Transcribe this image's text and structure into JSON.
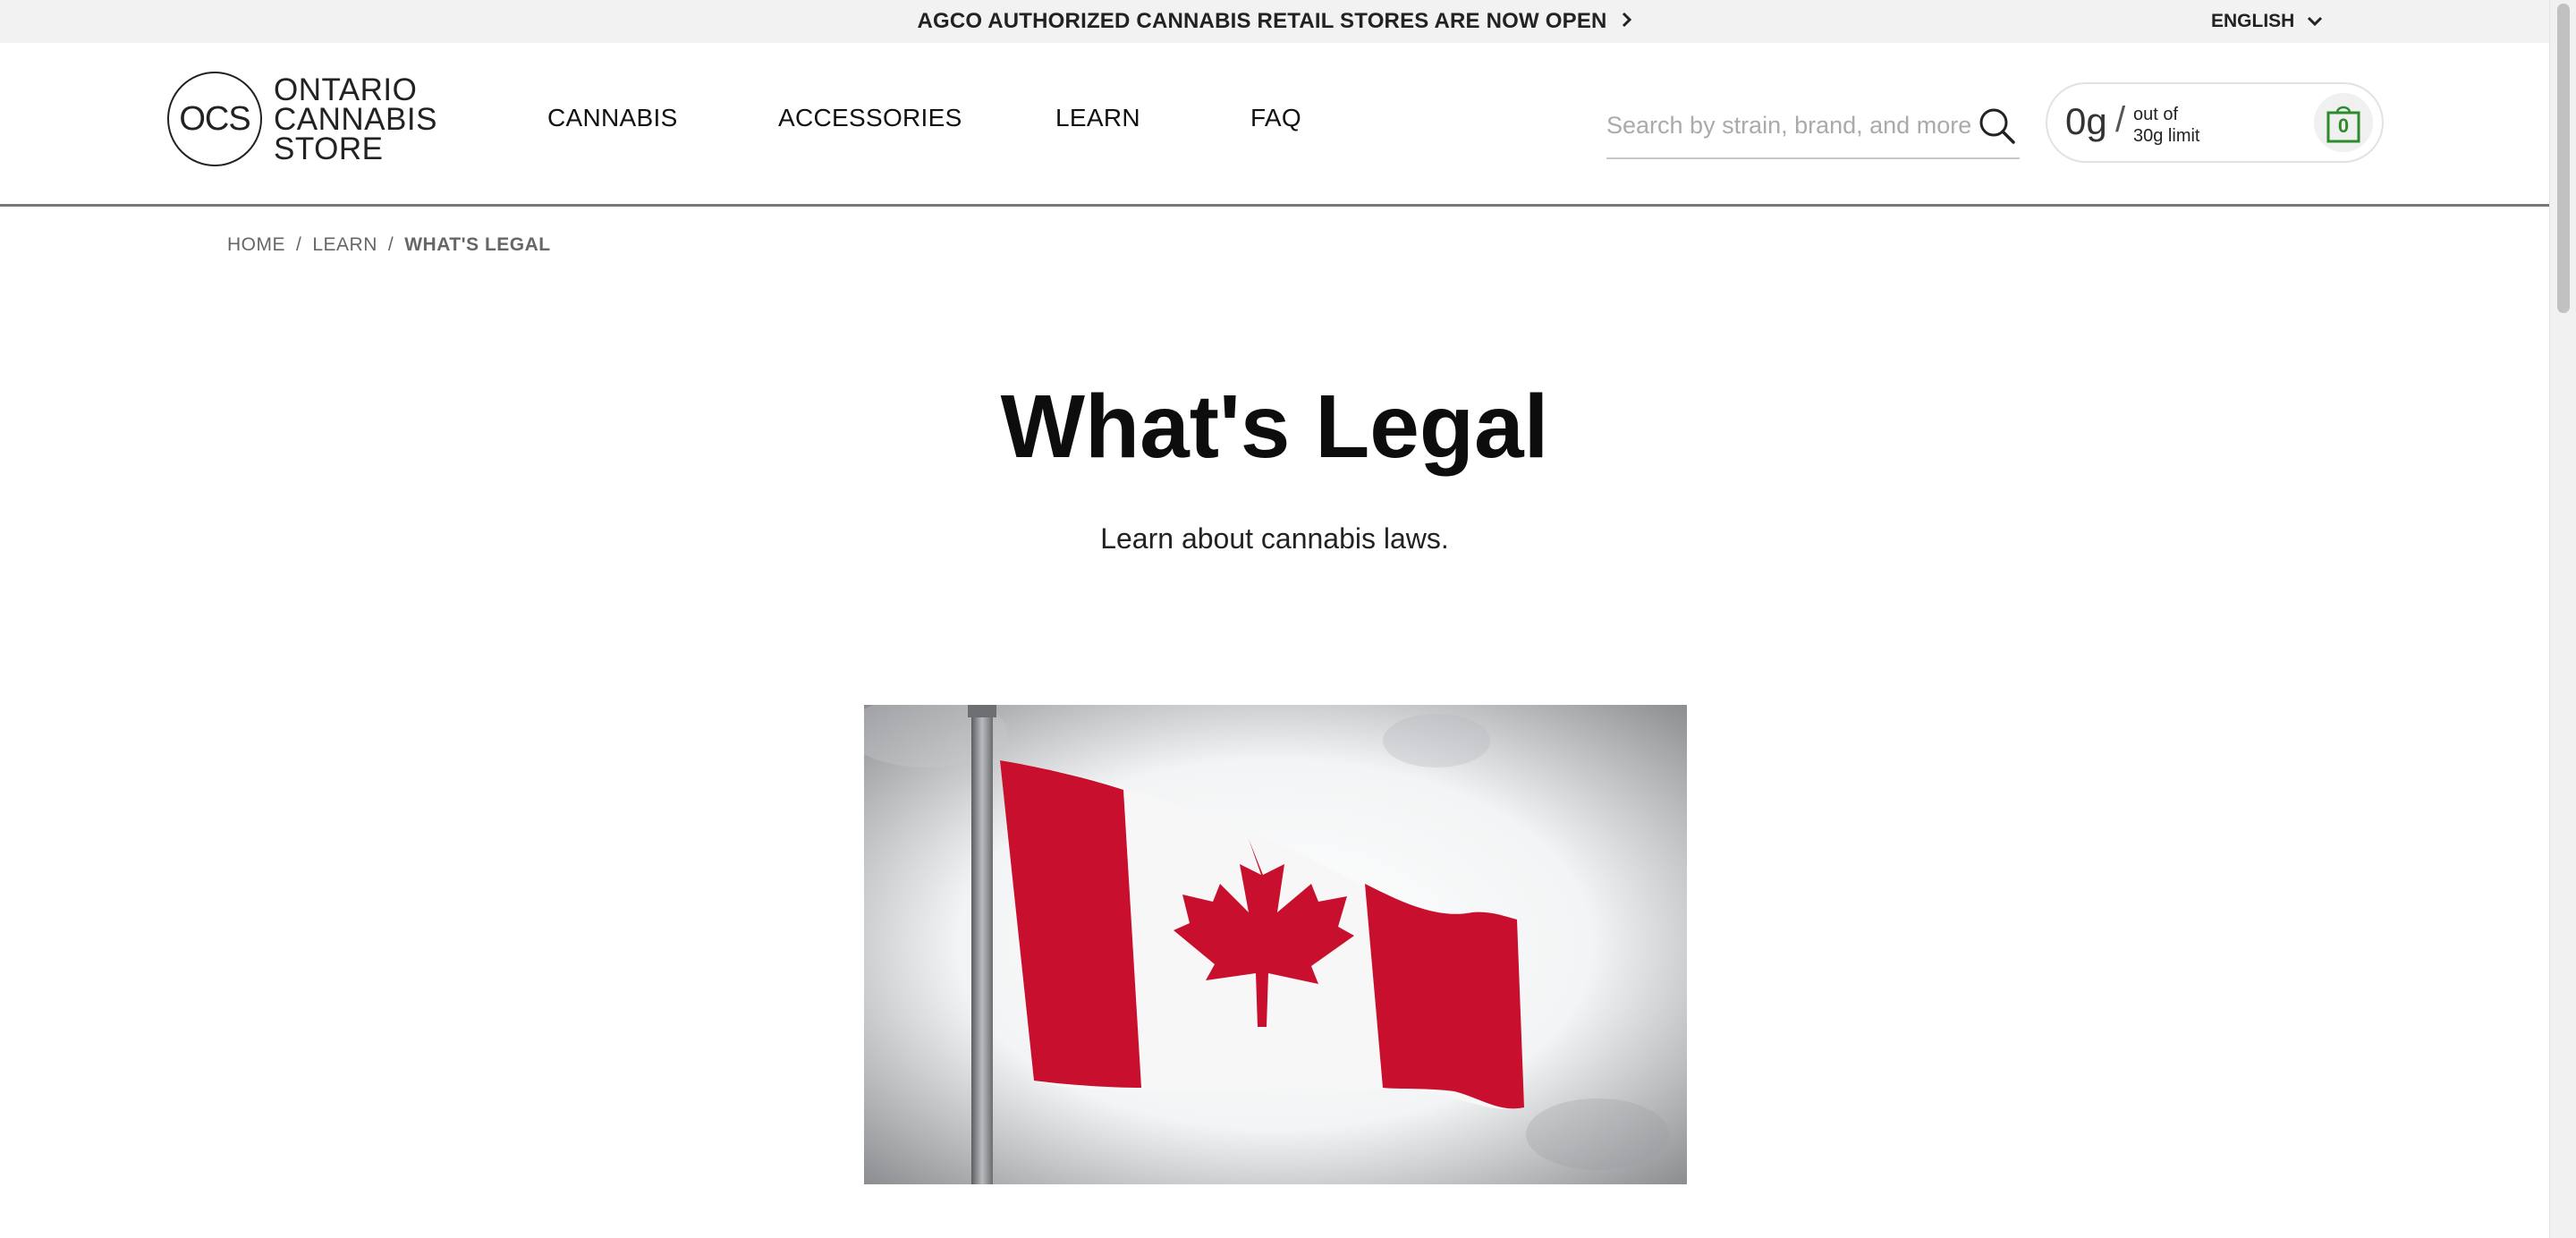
{
  "announcement": {
    "text": "AGCO AUTHORIZED CANNABIS RETAIL STORES ARE NOW OPEN"
  },
  "language": {
    "selected": "ENGLISH"
  },
  "logo": {
    "mark": "OCS",
    "line1": "ONTARIO",
    "line2": "CANNABIS",
    "line3": "STORE"
  },
  "nav": [
    {
      "label": "CANNABIS"
    },
    {
      "label": "ACCESSORIES"
    },
    {
      "label": "LEARN"
    },
    {
      "label": "FAQ"
    }
  ],
  "search": {
    "placeholder": "Search by strain, brand, and more",
    "value": ""
  },
  "limit": {
    "grams": "0g",
    "slash": "/",
    "line1": "out of",
    "line2": "30g limit"
  },
  "cart": {
    "count": "0"
  },
  "breadcrumb": {
    "home": "HOME",
    "sep": "/",
    "learn": "LEARN",
    "current": "WHAT'S LEGAL"
  },
  "page": {
    "title": "What's Legal",
    "subtitle": "Learn about cannabis laws."
  },
  "colors": {
    "flag_red": "#c8102e",
    "cart_green": "#2d8a2d",
    "topbar_bg": "#f2f2f2"
  }
}
